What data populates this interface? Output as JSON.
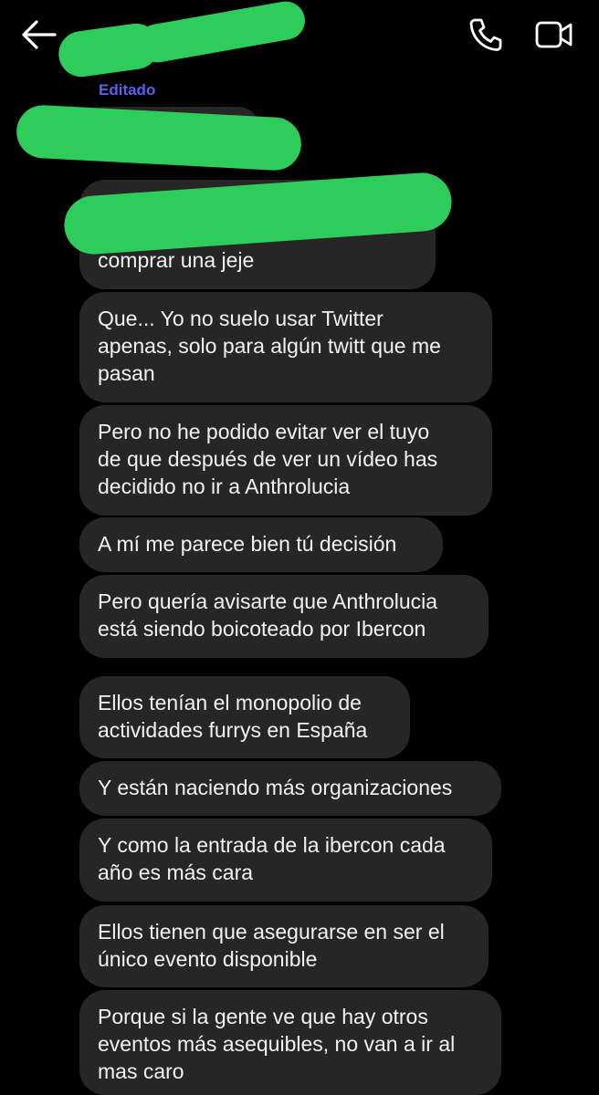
{
  "header": {
    "back_icon": "arrow-left-icon",
    "call_icon": "phone-icon",
    "video_icon": "video-camera-icon"
  },
  "edited_label": "Editado",
  "messages": [
    {
      "text": "comprar una jeje"
    },
    {
      "text": "Que... Yo no suelo usar Twitter\napenas, solo para algún twitt que me\npasan"
    },
    {
      "text": "Pero no he podido evitar ver el tuyo\nde que después de ver un vídeo has\ndecidido no ir a Anthrolucia"
    },
    {
      "text": "A mí me parece bien tú decisión"
    },
    {
      "text": "Pero quería avisarte que Anthrolucia\nestá siendo boicoteado por Ibercon"
    },
    {
      "text": "Ellos tenían el monopolio de\nactividades furrys en España"
    },
    {
      "text": "Y están naciendo más organizaciones"
    },
    {
      "text": "Y como la entrada de la ibercon cada\naño es más cara"
    },
    {
      "text": "Ellos tienen que asegurarse en ser el\núnico evento disponible"
    },
    {
      "text": "Porque si la gente ve que hay otros\neventos más asequibles, no van a ir al\nmas caro"
    }
  ],
  "colors": {
    "background": "#000000",
    "bubble": "#262626",
    "edited": "#5b62e8",
    "redaction": "#2ecc5a"
  }
}
